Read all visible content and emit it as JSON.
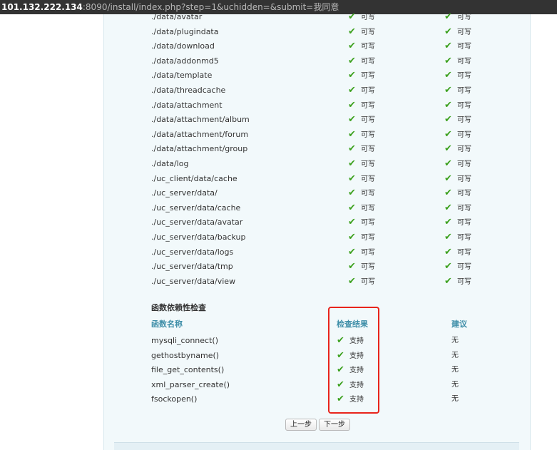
{
  "url": {
    "host": "101.132.222.134",
    "rest": ":8090/install/index.php?step=1&uchidden=&submit=我同意"
  },
  "directories": [
    {
      "path": "./data/avatar",
      "current": "可写",
      "required": "可写"
    },
    {
      "path": "./data/plugindata",
      "current": "可写",
      "required": "可写"
    },
    {
      "path": "./data/download",
      "current": "可写",
      "required": "可写"
    },
    {
      "path": "./data/addonmd5",
      "current": "可写",
      "required": "可写"
    },
    {
      "path": "./data/template",
      "current": "可写",
      "required": "可写"
    },
    {
      "path": "./data/threadcache",
      "current": "可写",
      "required": "可写"
    },
    {
      "path": "./data/attachment",
      "current": "可写",
      "required": "可写"
    },
    {
      "path": "./data/attachment/album",
      "current": "可写",
      "required": "可写"
    },
    {
      "path": "./data/attachment/forum",
      "current": "可写",
      "required": "可写"
    },
    {
      "path": "./data/attachment/group",
      "current": "可写",
      "required": "可写"
    },
    {
      "path": "./data/log",
      "current": "可写",
      "required": "可写"
    },
    {
      "path": "./uc_client/data/cache",
      "current": "可写",
      "required": "可写"
    },
    {
      "path": "./uc_server/data/",
      "current": "可写",
      "required": "可写"
    },
    {
      "path": "./uc_server/data/cache",
      "current": "可写",
      "required": "可写"
    },
    {
      "path": "./uc_server/data/avatar",
      "current": "可写",
      "required": "可写"
    },
    {
      "path": "./uc_server/data/backup",
      "current": "可写",
      "required": "可写"
    },
    {
      "path": "./uc_server/data/logs",
      "current": "可写",
      "required": "可写"
    },
    {
      "path": "./uc_server/data/tmp",
      "current": "可写",
      "required": "可写"
    },
    {
      "path": "./uc_server/data/view",
      "current": "可写",
      "required": "可写"
    }
  ],
  "functions_section": {
    "title": "函数依赖性检查",
    "headers": {
      "name": "函数名称",
      "result": "检查结果",
      "suggestion": "建议"
    },
    "rows": [
      {
        "name": "mysqli_connect()",
        "result": "支持",
        "suggestion": "无"
      },
      {
        "name": "gethostbyname()",
        "result": "支持",
        "suggestion": "无"
      },
      {
        "name": "file_get_contents()",
        "result": "支持",
        "suggestion": "无"
      },
      {
        "name": "xml_parser_create()",
        "result": "支持",
        "suggestion": "无"
      },
      {
        "name": "fsockopen()",
        "result": "支持",
        "suggestion": "无"
      }
    ]
  },
  "buttons": {
    "prev": "上一步",
    "next": "下一步"
  },
  "icons": {
    "check": "check-icon"
  },
  "colors": {
    "check": "#3da11f",
    "header": "#3e8ea8",
    "highlight": "#e8241c"
  }
}
